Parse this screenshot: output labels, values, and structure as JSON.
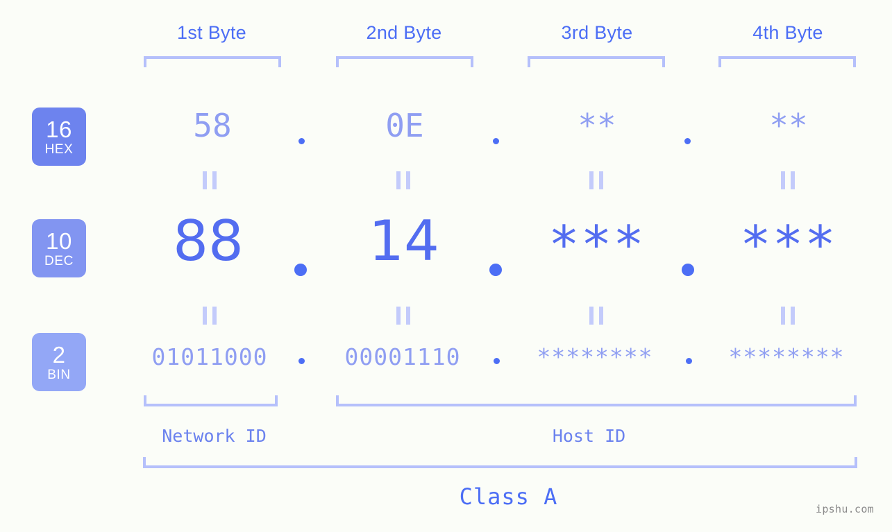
{
  "page": {
    "background": "#fbfdf8",
    "accent": "#4c6ef5",
    "accent_light": "#8f9ef2",
    "bracket_color": "#b5c0fb",
    "watermark": "ipshu.com"
  },
  "byte_headers": [
    {
      "label": "1st Byte"
    },
    {
      "label": "2nd Byte"
    },
    {
      "label": "3rd Byte"
    },
    {
      "label": "4th Byte"
    }
  ],
  "bases": [
    {
      "num": "16",
      "name": "HEX",
      "color": "#6d83ee"
    },
    {
      "num": "10",
      "name": "DEC",
      "color": "#8295f1"
    },
    {
      "num": "2",
      "name": "BIN",
      "color": "#93a7f6"
    }
  ],
  "rows": {
    "hex": {
      "base": "HEX",
      "values": [
        "58",
        "0E",
        "**",
        "**"
      ],
      "separators": [
        ".",
        ".",
        "."
      ]
    },
    "dec": {
      "base": "DEC",
      "values": [
        "88",
        "14",
        "***",
        "***"
      ],
      "separators": [
        ".",
        ".",
        "."
      ]
    },
    "bin": {
      "base": "BIN",
      "values": [
        "01011000",
        "00001110",
        "********",
        "********"
      ],
      "separators": [
        ".",
        ".",
        "."
      ]
    }
  },
  "equals_marks": {
    "symbol": "=",
    "count_per_row": 4,
    "rows": 2
  },
  "sections": {
    "network_id": "Network ID",
    "host_id": "Host ID",
    "class": "Class A"
  }
}
